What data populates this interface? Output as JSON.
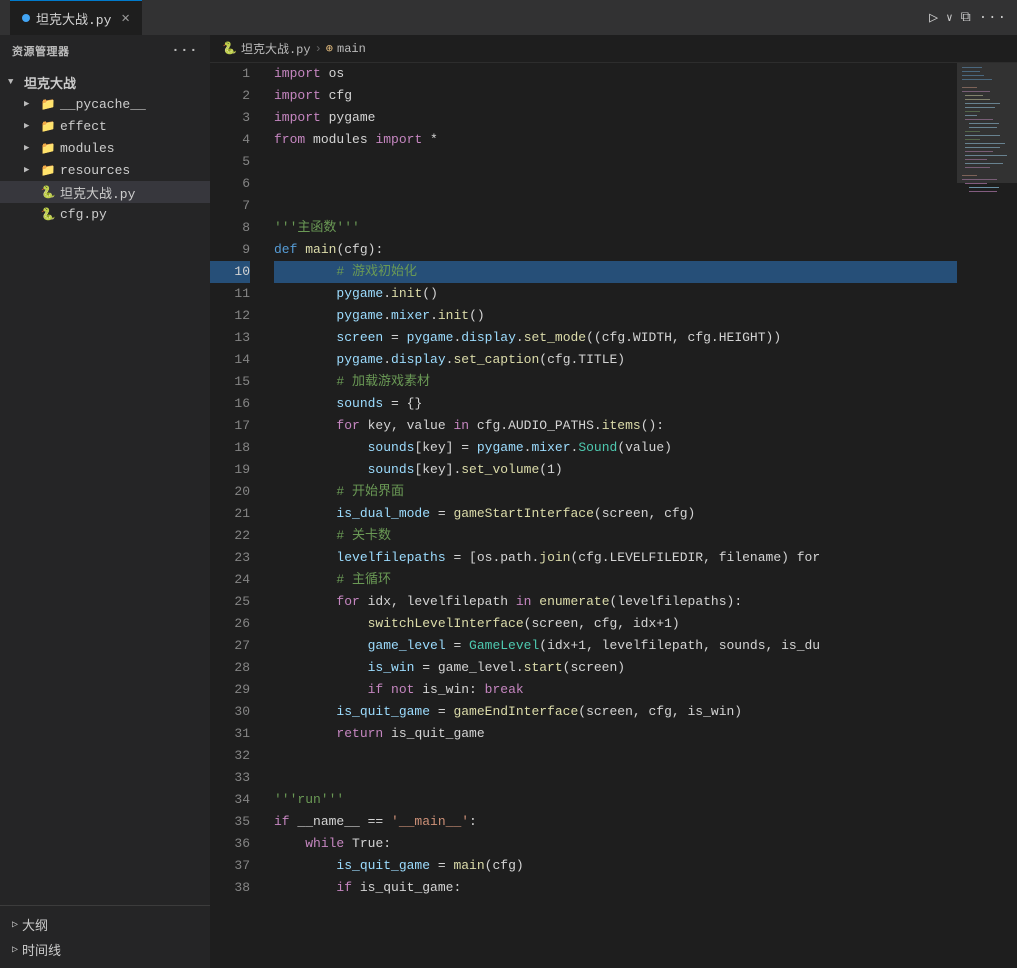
{
  "titlebar": {
    "tab_label": "坦克大战.py",
    "more_icon": "···",
    "run_icon": "▷",
    "split_icon": "⧉",
    "overflow_icon": "···"
  },
  "sidebar": {
    "header_label": "资源管理器",
    "more_icon": "···",
    "root_folder": "坦克大战",
    "items": [
      {
        "id": "pycache",
        "label": "__pycache__",
        "type": "folder",
        "indent": 1,
        "expanded": false
      },
      {
        "id": "effect",
        "label": "effect",
        "type": "folder",
        "indent": 1,
        "expanded": false
      },
      {
        "id": "modules",
        "label": "modules",
        "type": "folder",
        "indent": 1,
        "expanded": false
      },
      {
        "id": "resources",
        "label": "resources",
        "type": "folder",
        "indent": 1,
        "expanded": false
      },
      {
        "id": "tankwar_py",
        "label": "坦克大战.py",
        "type": "py",
        "indent": 1,
        "active": true
      },
      {
        "id": "cfg_py",
        "label": "cfg.py",
        "type": "py",
        "indent": 1
      }
    ],
    "footer_items": [
      {
        "id": "outline",
        "label": "大纲"
      },
      {
        "id": "timeline",
        "label": "时间线"
      }
    ]
  },
  "breadcrumb": {
    "file": "坦克大战.py",
    "symbol": "main"
  },
  "code": {
    "lines": [
      {
        "n": 1,
        "tokens": [
          {
            "t": "kw",
            "v": "import"
          },
          {
            "t": "plain",
            "v": " os"
          }
        ]
      },
      {
        "n": 2,
        "tokens": [
          {
            "t": "kw",
            "v": "import"
          },
          {
            "t": "plain",
            "v": " cfg"
          }
        ]
      },
      {
        "n": 3,
        "tokens": [
          {
            "t": "kw",
            "v": "import"
          },
          {
            "t": "plain",
            "v": " pygame"
          }
        ]
      },
      {
        "n": 4,
        "tokens": [
          {
            "t": "kw",
            "v": "from"
          },
          {
            "t": "plain",
            "v": " modules "
          },
          {
            "t": "kw",
            "v": "import"
          },
          {
            "t": "plain",
            "v": " *"
          }
        ]
      },
      {
        "n": 5,
        "tokens": []
      },
      {
        "n": 6,
        "tokens": []
      },
      {
        "n": 7,
        "tokens": []
      },
      {
        "n": 8,
        "tokens": [
          {
            "t": "str2",
            "v": "'''主函数'''"
          }
        ]
      },
      {
        "n": 9,
        "tokens": [
          {
            "t": "kw2",
            "v": "def"
          },
          {
            "t": "plain",
            "v": " "
          },
          {
            "t": "fn",
            "v": "main"
          },
          {
            "t": "plain",
            "v": "(cfg):"
          }
        ]
      },
      {
        "n": 10,
        "tokens": [
          {
            "t": "plain",
            "v": "        "
          },
          {
            "t": "cm",
            "v": "# 游戏初始化"
          }
        ],
        "highlighted": true
      },
      {
        "n": 11,
        "tokens": [
          {
            "t": "plain",
            "v": "        "
          },
          {
            "t": "var",
            "v": "pygame"
          },
          {
            "t": "plain",
            "v": "."
          },
          {
            "t": "method",
            "v": "init"
          },
          {
            "t": "plain",
            "v": "()"
          }
        ]
      },
      {
        "n": 12,
        "tokens": [
          {
            "t": "plain",
            "v": "        "
          },
          {
            "t": "var",
            "v": "pygame"
          },
          {
            "t": "plain",
            "v": "."
          },
          {
            "t": "var",
            "v": "mixer"
          },
          {
            "t": "plain",
            "v": "."
          },
          {
            "t": "method",
            "v": "init"
          },
          {
            "t": "plain",
            "v": "()"
          }
        ]
      },
      {
        "n": 13,
        "tokens": [
          {
            "t": "plain",
            "v": "        "
          },
          {
            "t": "var",
            "v": "screen"
          },
          {
            "t": "plain",
            "v": " = "
          },
          {
            "t": "var",
            "v": "pygame"
          },
          {
            "t": "plain",
            "v": "."
          },
          {
            "t": "var",
            "v": "display"
          },
          {
            "t": "plain",
            "v": "."
          },
          {
            "t": "method",
            "v": "set_mode"
          },
          {
            "t": "plain",
            "v": "((cfg.WIDTH, cfg.HEIGHT))"
          }
        ]
      },
      {
        "n": 14,
        "tokens": [
          {
            "t": "plain",
            "v": "        "
          },
          {
            "t": "var",
            "v": "pygame"
          },
          {
            "t": "plain",
            "v": "."
          },
          {
            "t": "var",
            "v": "display"
          },
          {
            "t": "plain",
            "v": "."
          },
          {
            "t": "method",
            "v": "set_caption"
          },
          {
            "t": "plain",
            "v": "(cfg.TITLE)"
          }
        ]
      },
      {
        "n": 15,
        "tokens": [
          {
            "t": "plain",
            "v": "        "
          },
          {
            "t": "cm",
            "v": "# 加载游戏素材"
          }
        ]
      },
      {
        "n": 16,
        "tokens": [
          {
            "t": "plain",
            "v": "        "
          },
          {
            "t": "var",
            "v": "sounds"
          },
          {
            "t": "plain",
            "v": " = {}"
          }
        ]
      },
      {
        "n": 17,
        "tokens": [
          {
            "t": "plain",
            "v": "        "
          },
          {
            "t": "kw",
            "v": "for"
          },
          {
            "t": "plain",
            "v": " key, value "
          },
          {
            "t": "kw",
            "v": "in"
          },
          {
            "t": "plain",
            "v": " cfg.AUDIO_PATHS."
          },
          {
            "t": "method",
            "v": "items"
          },
          {
            "t": "plain",
            "v": "():"
          }
        ]
      },
      {
        "n": 18,
        "tokens": [
          {
            "t": "plain",
            "v": "            "
          },
          {
            "t": "var",
            "v": "sounds"
          },
          {
            "t": "plain",
            "v": "[key] = "
          },
          {
            "t": "var",
            "v": "pygame"
          },
          {
            "t": "plain",
            "v": "."
          },
          {
            "t": "var",
            "v": "mixer"
          },
          {
            "t": "plain",
            "v": "."
          },
          {
            "t": "cls",
            "v": "Sound"
          },
          {
            "t": "plain",
            "v": "(value)"
          }
        ]
      },
      {
        "n": 19,
        "tokens": [
          {
            "t": "plain",
            "v": "            "
          },
          {
            "t": "var",
            "v": "sounds"
          },
          {
            "t": "plain",
            "v": "[key]."
          },
          {
            "t": "method",
            "v": "set_volume"
          },
          {
            "t": "plain",
            "v": "(1)"
          }
        ]
      },
      {
        "n": 20,
        "tokens": [
          {
            "t": "plain",
            "v": "        "
          },
          {
            "t": "cm",
            "v": "# 开始界面"
          }
        ]
      },
      {
        "n": 21,
        "tokens": [
          {
            "t": "plain",
            "v": "        "
          },
          {
            "t": "var",
            "v": "is_dual_mode"
          },
          {
            "t": "plain",
            "v": " = "
          },
          {
            "t": "method",
            "v": "gameStartInterface"
          },
          {
            "t": "plain",
            "v": "(screen, cfg)"
          }
        ]
      },
      {
        "n": 22,
        "tokens": [
          {
            "t": "plain",
            "v": "        "
          },
          {
            "t": "cm",
            "v": "# 关卡数"
          }
        ]
      },
      {
        "n": 23,
        "tokens": [
          {
            "t": "plain",
            "v": "        "
          },
          {
            "t": "var",
            "v": "levelfilepaths"
          },
          {
            "t": "plain",
            "v": " = [os.path."
          },
          {
            "t": "method",
            "v": "join"
          },
          {
            "t": "plain",
            "v": "(cfg.LEVELFILEDIR, filename) for"
          }
        ]
      },
      {
        "n": 24,
        "tokens": [
          {
            "t": "plain",
            "v": "        "
          },
          {
            "t": "cm",
            "v": "# 主循环"
          }
        ]
      },
      {
        "n": 25,
        "tokens": [
          {
            "t": "plain",
            "v": "        "
          },
          {
            "t": "kw",
            "v": "for"
          },
          {
            "t": "plain",
            "v": " idx, levelfilepath "
          },
          {
            "t": "kw",
            "v": "in"
          },
          {
            "t": "plain",
            "v": " "
          },
          {
            "t": "method",
            "v": "enumerate"
          },
          {
            "t": "plain",
            "v": "(levelfilepaths):"
          }
        ]
      },
      {
        "n": 26,
        "tokens": [
          {
            "t": "plain",
            "v": "            "
          },
          {
            "t": "method",
            "v": "switchLevelInterface"
          },
          {
            "t": "plain",
            "v": "(screen, cfg, idx+1)"
          }
        ]
      },
      {
        "n": 27,
        "tokens": [
          {
            "t": "plain",
            "v": "            "
          },
          {
            "t": "var",
            "v": "game_level"
          },
          {
            "t": "plain",
            "v": " = "
          },
          {
            "t": "cls",
            "v": "GameLevel"
          },
          {
            "t": "plain",
            "v": "(idx+1, levelfilepath, sounds, is_du"
          }
        ]
      },
      {
        "n": 28,
        "tokens": [
          {
            "t": "plain",
            "v": "            "
          },
          {
            "t": "var",
            "v": "is_win"
          },
          {
            "t": "plain",
            "v": " = game_level."
          },
          {
            "t": "method",
            "v": "start"
          },
          {
            "t": "plain",
            "v": "(screen)"
          }
        ]
      },
      {
        "n": 29,
        "tokens": [
          {
            "t": "plain",
            "v": "            "
          },
          {
            "t": "kw",
            "v": "if"
          },
          {
            "t": "plain",
            "v": " "
          },
          {
            "t": "kw",
            "v": "not"
          },
          {
            "t": "plain",
            "v": " is_win: "
          },
          {
            "t": "kw",
            "v": "break"
          }
        ]
      },
      {
        "n": 30,
        "tokens": [
          {
            "t": "plain",
            "v": "        "
          },
          {
            "t": "var",
            "v": "is_quit_game"
          },
          {
            "t": "plain",
            "v": " = "
          },
          {
            "t": "method",
            "v": "gameEndInterface"
          },
          {
            "t": "plain",
            "v": "(screen, cfg, is_win)"
          }
        ]
      },
      {
        "n": 31,
        "tokens": [
          {
            "t": "plain",
            "v": "        "
          },
          {
            "t": "kw",
            "v": "return"
          },
          {
            "t": "plain",
            "v": " is_quit_game"
          }
        ]
      },
      {
        "n": 32,
        "tokens": []
      },
      {
        "n": 33,
        "tokens": []
      },
      {
        "n": 34,
        "tokens": [
          {
            "t": "str2",
            "v": "'''run'''"
          }
        ]
      },
      {
        "n": 35,
        "tokens": [
          {
            "t": "kw",
            "v": "if"
          },
          {
            "t": "plain",
            "v": " __name__ == "
          },
          {
            "t": "str",
            "v": "'__main__'"
          },
          {
            "t": "plain",
            "v": ":"
          }
        ]
      },
      {
        "n": 36,
        "tokens": [
          {
            "t": "plain",
            "v": "    "
          },
          {
            "t": "kw",
            "v": "while"
          },
          {
            "t": "plain",
            "v": " True:"
          }
        ]
      },
      {
        "n": 37,
        "tokens": [
          {
            "t": "plain",
            "v": "        "
          },
          {
            "t": "var",
            "v": "is_quit_game"
          },
          {
            "t": "plain",
            "v": " = "
          },
          {
            "t": "method",
            "v": "main"
          },
          {
            "t": "plain",
            "v": "(cfg)"
          }
        ]
      },
      {
        "n": 38,
        "tokens": [
          {
            "t": "plain",
            "v": "        "
          },
          {
            "t": "kw",
            "v": "if"
          },
          {
            "t": "plain",
            "v": " is_quit_game:"
          }
        ]
      }
    ]
  }
}
